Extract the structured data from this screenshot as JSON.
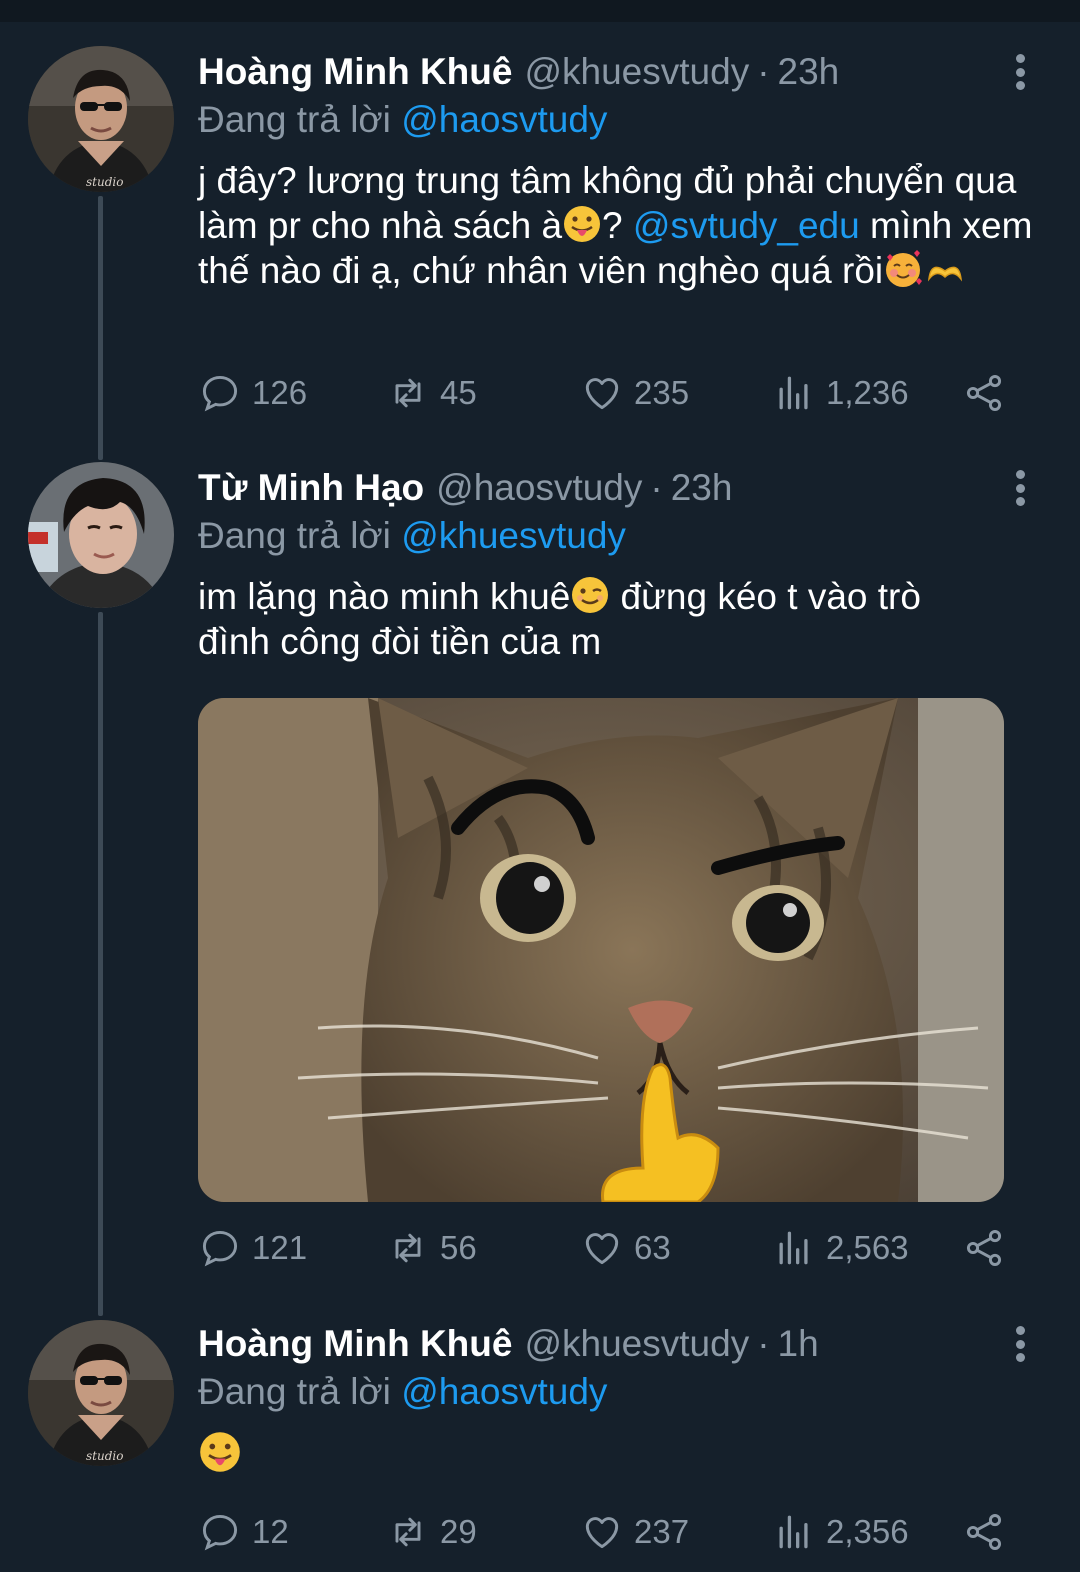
{
  "colors": {
    "background": "#15202b",
    "text_secondary": "#8b98a5",
    "accent": "#1d9bf0",
    "thread_line": "#3d4a56"
  },
  "tweets": [
    {
      "author_name": "Hoàng Minh Khuê",
      "handle": "@khuesvtudy",
      "separator": "·",
      "time": "23h",
      "replying_prefix": "Đang trả lời",
      "replying_to": "@haosvtudy",
      "text_1": "j đây? lương trung tâm không đủ phải chuyển qua làm pr cho nhà sách à",
      "emoji_1": "face-with-tongue",
      "text_2": "? ",
      "mention": "@svtudy_edu",
      "text_3": " mình xem thế nào đi ạ, chứ nhân viên nghèo quá rồi",
      "emoji_2": "smiling-face-with-hearts",
      "emoji_3": "heart-hands",
      "replies": "126",
      "retweets": "45",
      "likes": "235",
      "views": "1,236"
    },
    {
      "author_name": "Từ Minh Hạo",
      "handle": "@haosvtudy",
      "separator": "·",
      "time": "23h",
      "replying_prefix": "Đang trả lời",
      "replying_to": "@khuesvtudy",
      "text_1": "im lặng nào minh khuê",
      "emoji_1": "winking-face",
      "text_2": " đừng kéo t vào trò đình công đòi tiền của m",
      "media": "cat-meme-image",
      "replies": "121",
      "retweets": "56",
      "likes": "63",
      "views": "2,563"
    },
    {
      "author_name": "Hoàng Minh Khuê",
      "handle": "@khuesvtudy",
      "separator": "·",
      "time": "1h",
      "replying_prefix": "Đang trả lời",
      "replying_to": "@haosvtudy",
      "emoji_1": "face-with-tongue",
      "replies": "12",
      "retweets": "29",
      "likes": "237",
      "views": "2,356"
    }
  ]
}
